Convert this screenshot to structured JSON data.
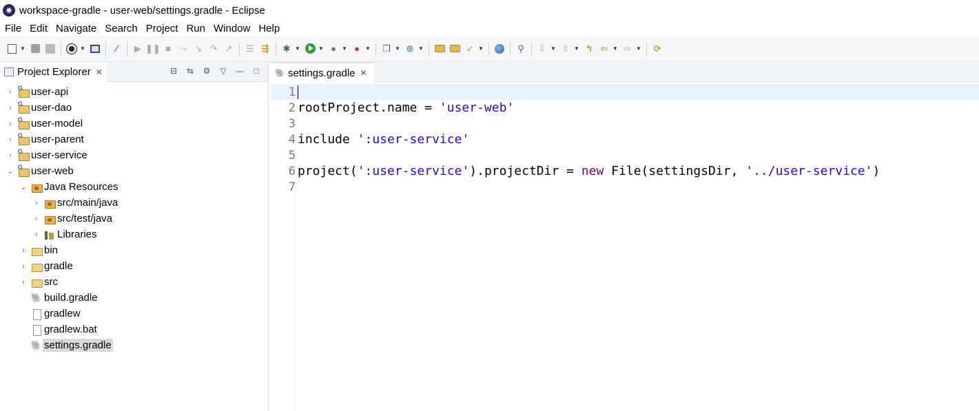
{
  "window": {
    "title": "workspace-gradle - user-web/settings.gradle - Eclipse"
  },
  "menu": [
    "File",
    "Edit",
    "Navigate",
    "Search",
    "Project",
    "Run",
    "Window",
    "Help"
  ],
  "project_explorer": {
    "tab_label": "Project Explorer",
    "tree": [
      {
        "label": "user-api",
        "icon": "gradle-project-icon",
        "expand": "collapsed",
        "depth": 0
      },
      {
        "label": "user-dao",
        "icon": "gradle-project-icon",
        "expand": "collapsed",
        "depth": 0
      },
      {
        "label": "user-model",
        "icon": "gradle-project-icon",
        "expand": "collapsed",
        "depth": 0
      },
      {
        "label": "user-parent",
        "icon": "gradle-project-icon",
        "expand": "collapsed",
        "depth": 0
      },
      {
        "label": "user-service",
        "icon": "gradle-project-icon",
        "expand": "collapsed",
        "depth": 0
      },
      {
        "label": "user-web",
        "icon": "gradle-project-icon",
        "expand": "expanded",
        "depth": 0
      },
      {
        "label": "Java Resources",
        "icon": "java-resources-icon",
        "expand": "expanded",
        "depth": 1
      },
      {
        "label": "src/main/java",
        "icon": "package-folder-icon",
        "expand": "collapsed",
        "depth": 2
      },
      {
        "label": "src/test/java",
        "icon": "package-folder-icon",
        "expand": "collapsed",
        "depth": 2
      },
      {
        "label": "Libraries",
        "icon": "libraries-icon",
        "expand": "collapsed",
        "depth": 2
      },
      {
        "label": "bin",
        "icon": "folder-icon",
        "expand": "collapsed",
        "depth": 1
      },
      {
        "label": "gradle",
        "icon": "folder-icon",
        "expand": "collapsed",
        "depth": 1
      },
      {
        "label": "src",
        "icon": "folder-icon",
        "expand": "collapsed",
        "depth": 1
      },
      {
        "label": "build.gradle",
        "icon": "gradle-file-icon",
        "expand": "none",
        "depth": 1
      },
      {
        "label": "gradlew",
        "icon": "file-icon",
        "expand": "none",
        "depth": 1
      },
      {
        "label": "gradlew.bat",
        "icon": "file-icon",
        "expand": "none",
        "depth": 1
      },
      {
        "label": "settings.gradle",
        "icon": "gradle-file-icon",
        "expand": "none",
        "depth": 1,
        "selected": true
      }
    ]
  },
  "editor": {
    "tab_label": "settings.gradle",
    "lines": [
      {
        "num": "1",
        "segments": []
      },
      {
        "num": "2",
        "segments": [
          {
            "t": "plain",
            "text": "rootProject.name = "
          },
          {
            "t": "str",
            "text": "'user-web'"
          }
        ]
      },
      {
        "num": "3",
        "segments": []
      },
      {
        "num": "4",
        "segments": [
          {
            "t": "plain",
            "text": "include "
          },
          {
            "t": "str",
            "text": "':user-service'"
          }
        ]
      },
      {
        "num": "5",
        "segments": []
      },
      {
        "num": "6",
        "segments": [
          {
            "t": "plain",
            "text": "project("
          },
          {
            "t": "str",
            "text": "':user-service'"
          },
          {
            "t": "plain",
            "text": ").projectDir = "
          },
          {
            "t": "kw",
            "text": "new"
          },
          {
            "t": "plain",
            "text": " File(settingsDir, "
          },
          {
            "t": "str",
            "text": "'../user-service'"
          },
          {
            "t": "plain",
            "text": ")"
          }
        ]
      },
      {
        "num": "7",
        "segments": []
      }
    ],
    "current_line": 1
  },
  "colors": {
    "string": "#2a00ff",
    "keyword": "#7f0055",
    "current_line": "#e8f2fe",
    "selection": "#d9d9d9"
  }
}
